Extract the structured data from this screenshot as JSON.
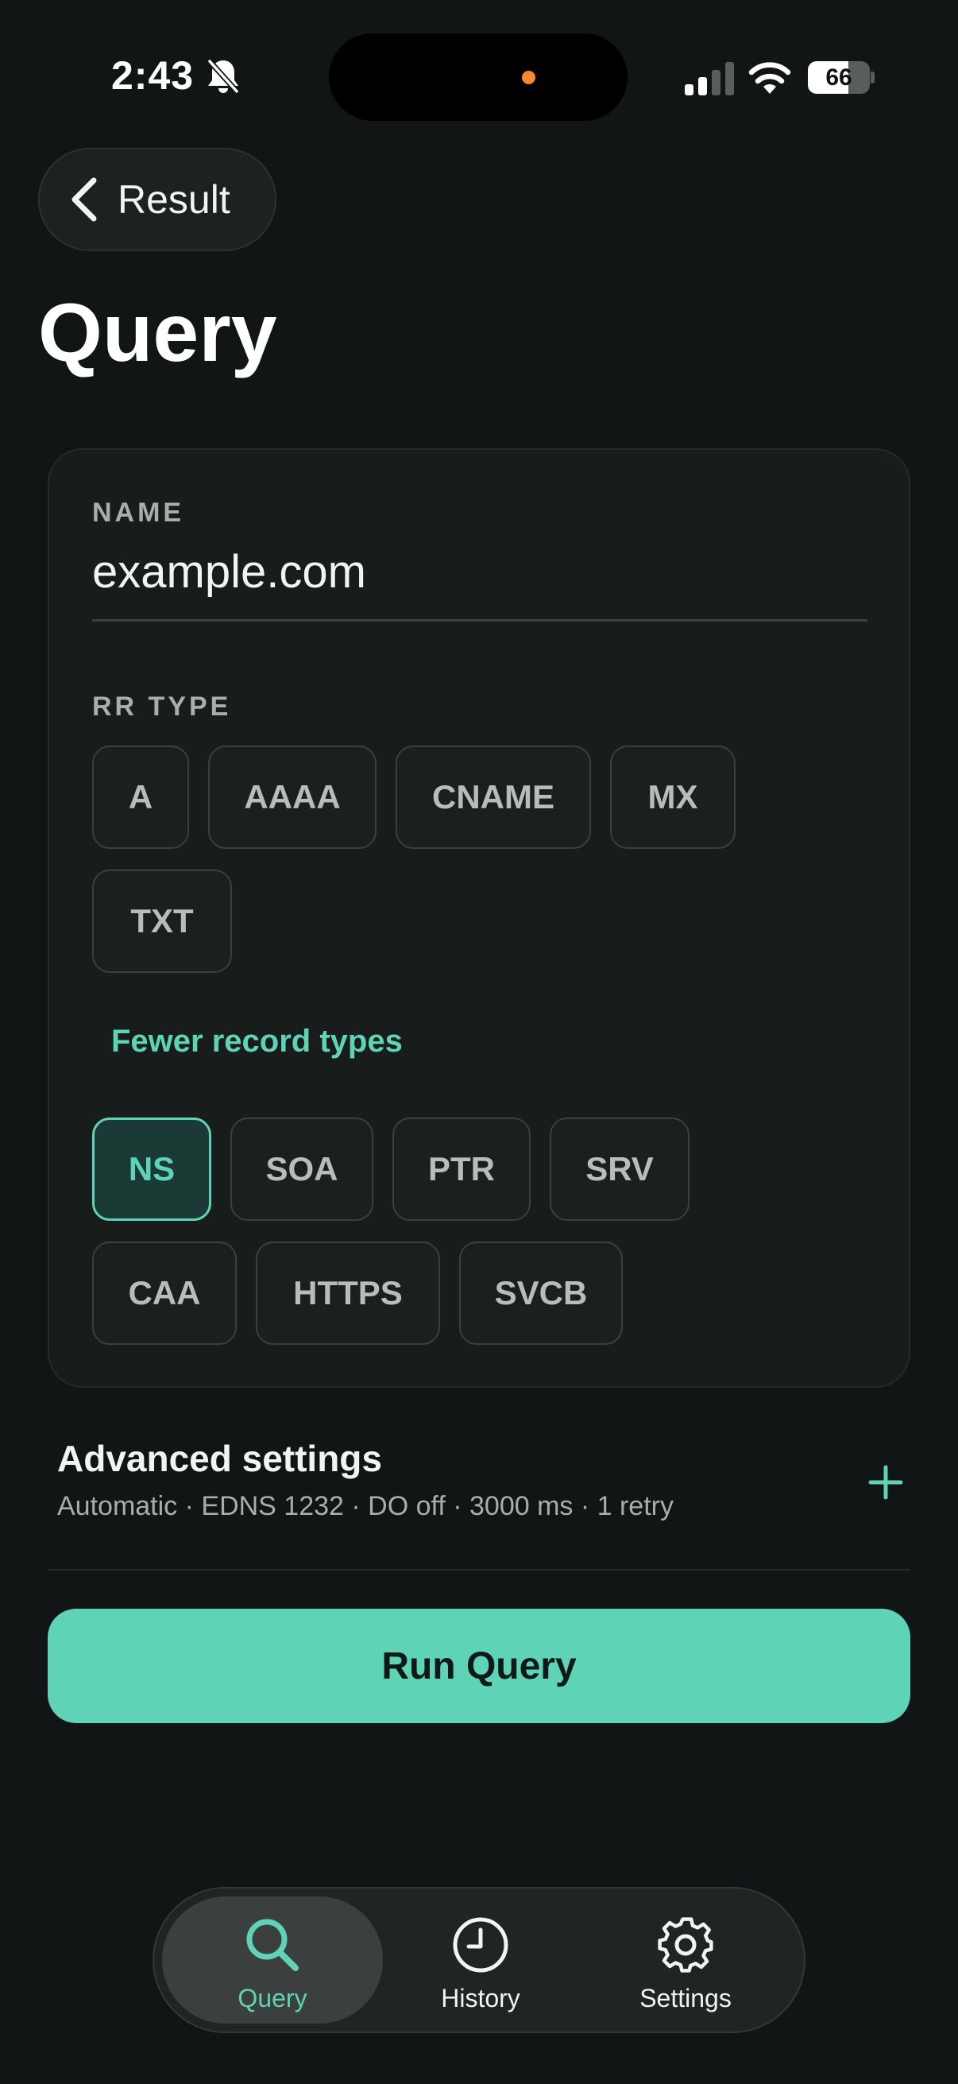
{
  "status_bar": {
    "time": "2:43",
    "battery_level": "66",
    "battery_fraction": 0.66,
    "icons": [
      "bell-slash-icon",
      "cellular-signal-icon",
      "wifi-icon",
      "battery-icon"
    ]
  },
  "nav": {
    "back_label": "Result",
    "back_icon": "chevron-left-icon"
  },
  "page_title": "Query",
  "form": {
    "name_label": "NAME",
    "name_value": "example.com",
    "rr_type_label": "RR TYPE",
    "common_types": [
      "A",
      "AAAA",
      "CNAME",
      "MX",
      "TXT"
    ],
    "toggle_label": "Fewer record types",
    "extra_types": [
      "NS",
      "SOA",
      "PTR",
      "SRV",
      "CAA",
      "HTTPS",
      "SVCB"
    ],
    "selected_type": "NS"
  },
  "advanced": {
    "title": "Advanced settings",
    "summary": "Automatic · EDNS 1232 · DO off · 3000 ms · 1 retry",
    "expand_icon": "plus-icon"
  },
  "run_button_label": "Run Query",
  "tabs": [
    {
      "label": "Query",
      "icon": "search-icon",
      "active": true
    },
    {
      "label": "History",
      "icon": "clock-icon",
      "active": false
    },
    {
      "label": "Settings",
      "icon": "gear-icon",
      "active": false
    }
  ],
  "colors": {
    "background": "#121515",
    "card": "#181c1b",
    "accent": "#5fd3b5",
    "text": "#f2f4f3",
    "muted": "#a7afac"
  }
}
